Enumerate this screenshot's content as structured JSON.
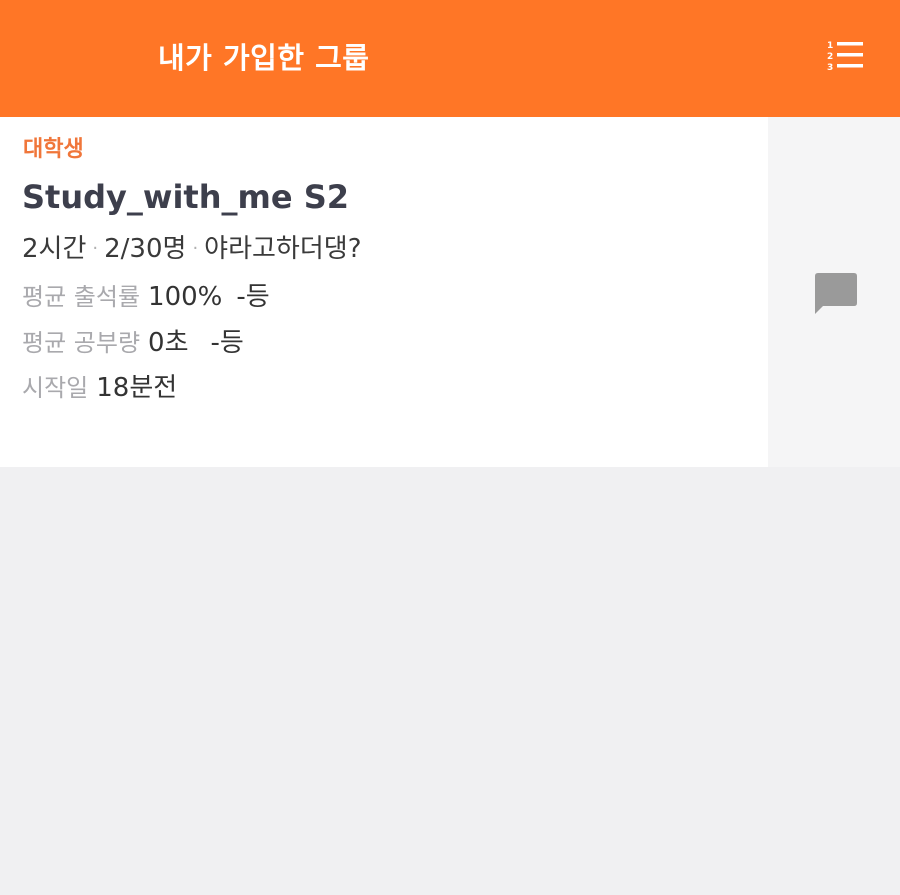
{
  "header": {
    "title": "내가 가입한 그룹",
    "sort_icon": "numbered-list-icon",
    "background_color": "#ff7626"
  },
  "group": {
    "category": "대학생",
    "title": "Study_with_me S2",
    "duration": "2시간",
    "members": "2/30명",
    "description": "야라고하더댕?",
    "attendance_label": "평균 출석률",
    "attendance_value": "100%",
    "attendance_rank": "-등",
    "study_label": "평균 공부량",
    "study_value": "0초",
    "study_rank": "-등",
    "start_label": "시작일",
    "start_value": "18분전",
    "chat_icon": "chat-bubble-icon",
    "accent_color": "#f0763a"
  }
}
